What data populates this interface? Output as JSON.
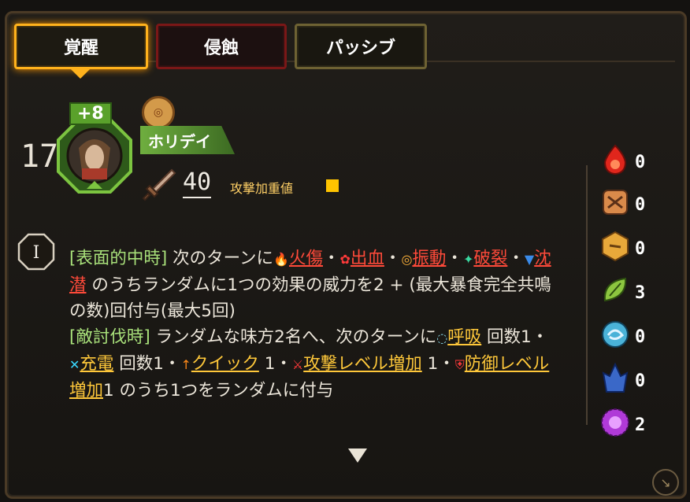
{
  "tabs": [
    {
      "label": "覚醒",
      "active": true
    },
    {
      "label": "侵蝕",
      "active": false
    },
    {
      "label": "パッシブ",
      "active": false
    }
  ],
  "character": {
    "level": "17",
    "plus": "+8",
    "name": "ホリデイ",
    "attack_value": "40",
    "attack_label": "攻撃加重値"
  },
  "skill": {
    "roman": "I",
    "text": {
      "cond1": "[表面的中時]",
      "t1": " 次のターンに",
      "e1": "火傷",
      "s1": "・",
      "e2": "出血",
      "s2": "・",
      "e3": "振動",
      "s3": "・",
      "e4": "破裂",
      "s4": "・",
      "e5": "沈潜",
      "t2": " のうちランダムに1つの効果の威力を2 + (最大暴食完全共鳴の数)回付与(最大5回)",
      "cond2": "[敵討伐時]",
      "t3": " ランダムな味方2名へ、次のターンに",
      "b1": "呼吸",
      "t4": " 回数1・",
      "b2": "充電",
      "t5": " 回数1・",
      "b3": "クイック",
      "t6": " 1・",
      "b4": "攻撃レベル増加",
      "t7": " 1・",
      "b5": "防御レベル増加",
      "t8": "1 のうち1つをランダムに付与"
    }
  },
  "resources": [
    {
      "name": "wrath",
      "count": "0",
      "color": "#e0261c"
    },
    {
      "name": "lust",
      "count": "0",
      "color": "#d98a4a"
    },
    {
      "name": "sloth",
      "count": "0",
      "color": "#e8a83a"
    },
    {
      "name": "gluttony",
      "count": "3",
      "color": "#8cc63f"
    },
    {
      "name": "gloom",
      "count": "0",
      "color": "#4ab2d8"
    },
    {
      "name": "pride",
      "count": "0",
      "color": "#3a68c8"
    },
    {
      "name": "envy",
      "count": "2",
      "color": "#b03ad8"
    }
  ],
  "colors": {
    "accent": "#ffb21c",
    "effect_red": "#ff4a3a",
    "buff_yellow": "#ffc83a",
    "cond_green": "#a8e07a"
  }
}
